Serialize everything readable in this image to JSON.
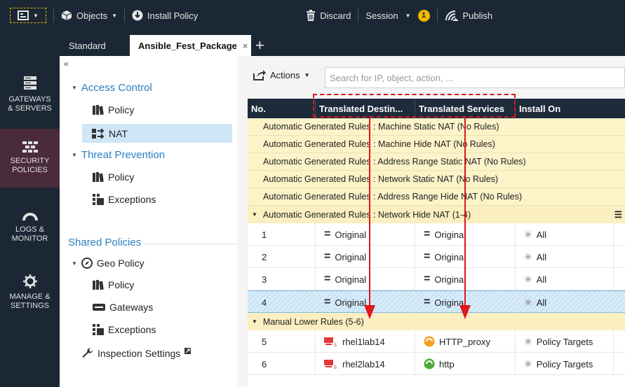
{
  "topbar": {
    "objects": "Objects",
    "install_policy": "Install Policy",
    "discard": "Discard",
    "session": "Session",
    "session_badge": "1",
    "publish": "Publish"
  },
  "tabs": {
    "standard": "Standard",
    "active": "Ansible_Fest_Package",
    "close": "×",
    "add": "+"
  },
  "leftnav": [
    {
      "label1": "GATEWAYS",
      "label2": "& SERVERS"
    },
    {
      "label1": "SECURITY",
      "label2": "POLICIES"
    },
    {
      "label1": "LOGS &",
      "label2": "MONITOR"
    },
    {
      "label1": "MANAGE &",
      "label2": "SETTINGS"
    }
  ],
  "tree": {
    "collapse": "«",
    "access_control": "Access Control",
    "ac_policy": "Policy",
    "nat": "NAT",
    "threat_prevention": "Threat Prevention",
    "tp_policy": "Policy",
    "tp_exceptions": "Exceptions",
    "shared_policies": "Shared Policies",
    "geo_policy": "Geo Policy",
    "geo_policy_item": "Policy",
    "gateways": "Gateways",
    "geo_exceptions": "Exceptions",
    "inspection_settings": "Inspection Settings"
  },
  "toolbar": {
    "actions": "Actions",
    "search_placeholder": "Search for IP, object, action, ..."
  },
  "grid": {
    "columns": {
      "no": "No.",
      "translated_destination": "Translated Destin...",
      "translated_services": "Translated Services",
      "install_on": "Install On"
    },
    "auto_rules": [
      "Automatic Generated Rules : Machine Static NAT (No Rules)",
      "Automatic Generated Rules : Machine Hide NAT (No Rules)",
      "Automatic Generated Rules : Address Range Static NAT (No Rules)",
      "Automatic Generated Rules : Network Static NAT (No Rules)",
      "Automatic Generated Rules : Address Range Hide NAT (No Rules)"
    ],
    "network_hide_section": "Automatic Generated Rules : Network Hide NAT (1-4)",
    "rows": [
      {
        "no": "1",
        "dest": "Original",
        "svc": "Original",
        "install": "All"
      },
      {
        "no": "2",
        "dest": "Original",
        "svc": "Original",
        "install": "All"
      },
      {
        "no": "3",
        "dest": "Original",
        "svc": "Original",
        "install": "All"
      },
      {
        "no": "4",
        "dest": "Original",
        "svc": "Original",
        "install": "All"
      }
    ],
    "manual_section": "Manual Lower Rules (5-6)",
    "manual_rows": [
      {
        "no": "5",
        "dest": "rhel1lab14",
        "svc": "HTTP_proxy",
        "install": "Policy Targets"
      },
      {
        "no": "6",
        "dest": "rhel2lab14",
        "svc": "http",
        "install": "Policy Targets"
      }
    ]
  },
  "colors": {
    "annotation": "#e0161b",
    "nav_bg": "#1b2734",
    "accent_blue": "#2a7fc1"
  }
}
